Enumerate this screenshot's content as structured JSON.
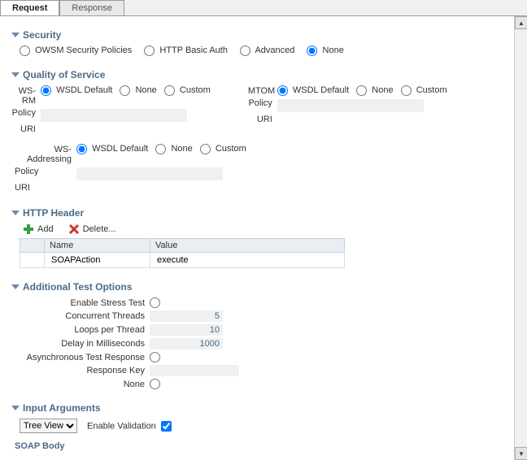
{
  "tabs": {
    "request": "Request",
    "response": "Response"
  },
  "security": {
    "title": "Security",
    "owsm": "OWSM Security Policies",
    "http": "HTTP Basic Auth",
    "adv": "Advanced",
    "none": "None"
  },
  "qos": {
    "title": "Quality of Service",
    "wsrm": "WS-RM",
    "mtom": "MTOM",
    "wsaddr": "WS-Addressing",
    "policy": "Policy",
    "uri": "URI",
    "wsdl_default": "WSDL Default",
    "none": "None",
    "custom": "Custom"
  },
  "http": {
    "title": "HTTP Header",
    "add": "Add",
    "delete": "Delete...",
    "col_name": "Name",
    "col_value": "Value",
    "row_name": "SOAPAction",
    "row_value": "execute"
  },
  "opts": {
    "title": "Additional Test Options",
    "stress": "Enable Stress Test",
    "threads": "Concurrent Threads",
    "threads_v": "5",
    "loops": "Loops per Thread",
    "loops_v": "10",
    "delay": "Delay in Milliseconds",
    "delay_v": "1000",
    "async": "Asynchronous Test Response",
    "respkey": "Response Key",
    "none": "None"
  },
  "args": {
    "title": "Input Arguments",
    "treeview": "Tree View",
    "enable_val": "Enable Validation"
  },
  "soap": {
    "body": "SOAP Body"
  }
}
